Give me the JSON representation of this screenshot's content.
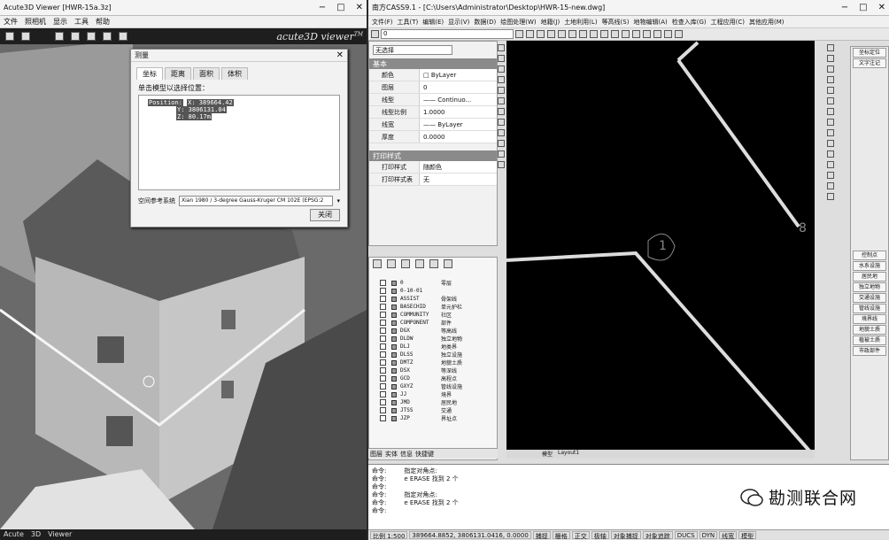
{
  "left_window": {
    "title": "Acute3D Viewer [HWR-15a.3z]",
    "menu": [
      "文件",
      "照相机",
      "显示",
      "工具",
      "帮助"
    ],
    "brand": "acute3D viewer",
    "brand_tm": "TM",
    "dialog": {
      "title": "测量",
      "tabs": [
        "坐标",
        "距离",
        "面积",
        "体积"
      ],
      "active_tab": 0,
      "label": "单击模型以选择位置：",
      "coords": [
        "X: 389664.42",
        "Y: 3806131.04",
        "Z: 80.17m"
      ],
      "coord_prefix": "Position:",
      "crs_label": "空间参考系统",
      "crs_value": "Xian 1980 / 3-degree Gauss-Kruger CM 102E (EPSG:2",
      "close_label": "关闭"
    },
    "status_items": [
      "Acute",
      "3D",
      "Viewer"
    ]
  },
  "right_window": {
    "title": "南方CASS9.1 - [C:\\Users\\Administrator\\Desktop\\HWR-15-new.dwg]",
    "menu": [
      "文件(F)",
      "工具(T)",
      "编辑(E)",
      "显示(V)",
      "数据(D)",
      "绘图处理(W)",
      "地籍(J)",
      "土地利用(L)",
      "等高线(S)",
      "地物编辑(A)",
      "检查入库(G)",
      "工程应用(C)",
      "其他应用(M)"
    ],
    "layer_combo": "0",
    "props": {
      "selection": "无选择",
      "section_basic": "基本",
      "rows": [
        {
          "k": "颜色",
          "v": "□ ByLayer"
        },
        {
          "k": "图层",
          "v": "0"
        },
        {
          "k": "线型",
          "v": "—— Continuo..."
        },
        {
          "k": "线型比例",
          "v": "1.0000"
        },
        {
          "k": "线宽",
          "v": "—— ByLayer"
        },
        {
          "k": "厚度",
          "v": "0.0000"
        }
      ],
      "section_print": "打印样式",
      "print_rows": [
        {
          "k": "打印样式",
          "v": "随颜色"
        },
        {
          "k": "打印样式表",
          "v": "无"
        }
      ]
    },
    "layers": [
      {
        "code": "0",
        "name": "零层"
      },
      {
        "code": "0-10-01",
        "name": ""
      },
      {
        "code": "ASSIST",
        "name": "骨架线"
      },
      {
        "code": "BASECHID",
        "name": "单元护栏"
      },
      {
        "code": "COMMUNITY",
        "name": "社区"
      },
      {
        "code": "COMPONENT",
        "name": "部件"
      },
      {
        "code": "DGX",
        "name": "等高线"
      },
      {
        "code": "DLDW",
        "name": "独立地物"
      },
      {
        "code": "DLJ",
        "name": "地类界"
      },
      {
        "code": "DLSS",
        "name": "独立设施"
      },
      {
        "code": "DMTZ",
        "name": "地貌土质"
      },
      {
        "code": "DSX",
        "name": "等深线"
      },
      {
        "code": "GCD",
        "name": "高程点"
      },
      {
        "code": "GXYZ",
        "name": "管线设施"
      },
      {
        "code": "JJ",
        "name": "境界"
      },
      {
        "code": "JMD",
        "name": "居民地"
      },
      {
        "code": "JTSS",
        "name": "交通"
      },
      {
        "code": "JZP",
        "name": "界址点"
      }
    ],
    "layer_tabs": [
      "图层",
      "实体",
      "信息",
      "快捷键"
    ],
    "drawing_labels": [
      "1",
      "8"
    ],
    "model_tabs": [
      "模型",
      "Layout1"
    ],
    "right_panel_top": [
      "坐标定位",
      "文字注记",
      "控制点",
      "水系设施",
      "居民地",
      "独立地物",
      "交通设施",
      "管线设施",
      "境界线",
      "地貌土质",
      "植被土质",
      "市政部件"
    ],
    "command_lines": [
      {
        "a": "命令:",
        "b": "指定对角点:"
      },
      {
        "a": "命令:",
        "b": "e ERASE 找到 2 个"
      },
      {
        "a": "命令:",
        "b": ""
      },
      {
        "a": "命令:",
        "b": "指定对角点:"
      },
      {
        "a": "命令:",
        "b": "e ERASE 找到 2 个"
      },
      {
        "a": "命令:",
        "b": ""
      }
    ],
    "status": [
      "比例 1:500",
      "389664.8852, 3806131.0416, 0.0000",
      "捕捉",
      "栅格",
      "正交",
      "极轴",
      "对象捕捉",
      "对象追踪",
      "DUCS",
      "DYN",
      "线宽",
      "模型"
    ]
  },
  "watermark": "勘测联合网"
}
